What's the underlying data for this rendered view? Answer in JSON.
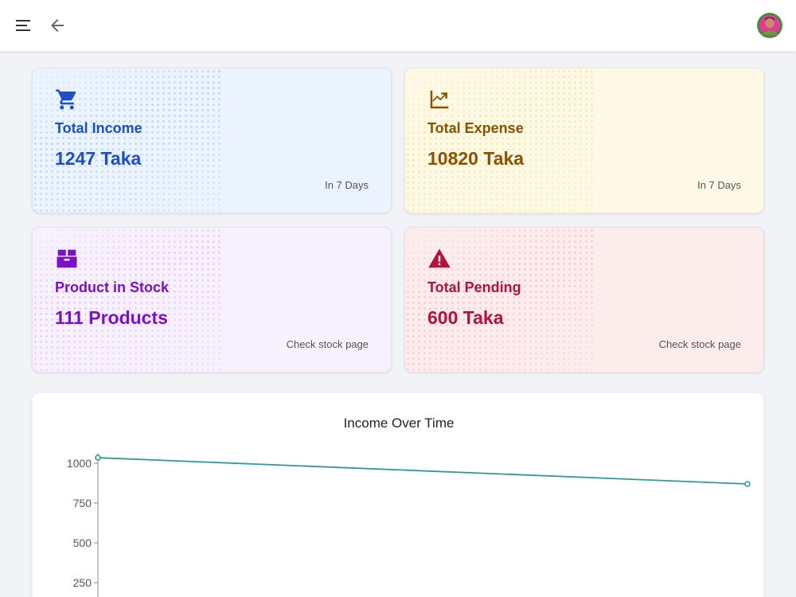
{
  "topbar": {
    "menu_icon": "hamburger-menu-icon",
    "back_icon": "arrow-left-icon",
    "avatar": "user-avatar"
  },
  "cards": [
    {
      "id": "income",
      "icon": "shopping-cart-icon",
      "title": "Total Income",
      "value": "1247 Taka",
      "note": "In 7 Days",
      "color": "#1f4fc8",
      "background": "#eaf3fe",
      "dot_color": "#7fb0ee"
    },
    {
      "id": "expense",
      "icon": "trending-up-chart-icon",
      "title": "Total Expense",
      "value": "10820 Taka",
      "note": "In 7 Days",
      "color": "#8a5207",
      "background": "#fdf9e6",
      "dot_color": "#f3d45a"
    },
    {
      "id": "stock",
      "icon": "inventory-box-icon",
      "title": "Product in Stock",
      "value": "111 Products",
      "note": "Check stock page",
      "color": "#7a10c8",
      "background": "#f7f0fd",
      "dot_color": "#d2a6f2"
    },
    {
      "id": "pending",
      "icon": "warning-triangle-icon",
      "title": "Total Pending",
      "value": "600 Taka",
      "note": "Check stock page",
      "color": "#b0143c",
      "background": "#fdecec",
      "dot_color": "#f4a0b4"
    }
  ],
  "chart_data": {
    "type": "line",
    "title": "Income Over Time",
    "xlabel": "",
    "ylabel": "",
    "y_ticks": [
      1000,
      750,
      500,
      250
    ],
    "ylim": [
      0,
      1050
    ],
    "x": [
      0,
      1
    ],
    "series": [
      {
        "values": [
          1035,
          870
        ],
        "color": "#2a9d95"
      }
    ],
    "grid": false
  }
}
